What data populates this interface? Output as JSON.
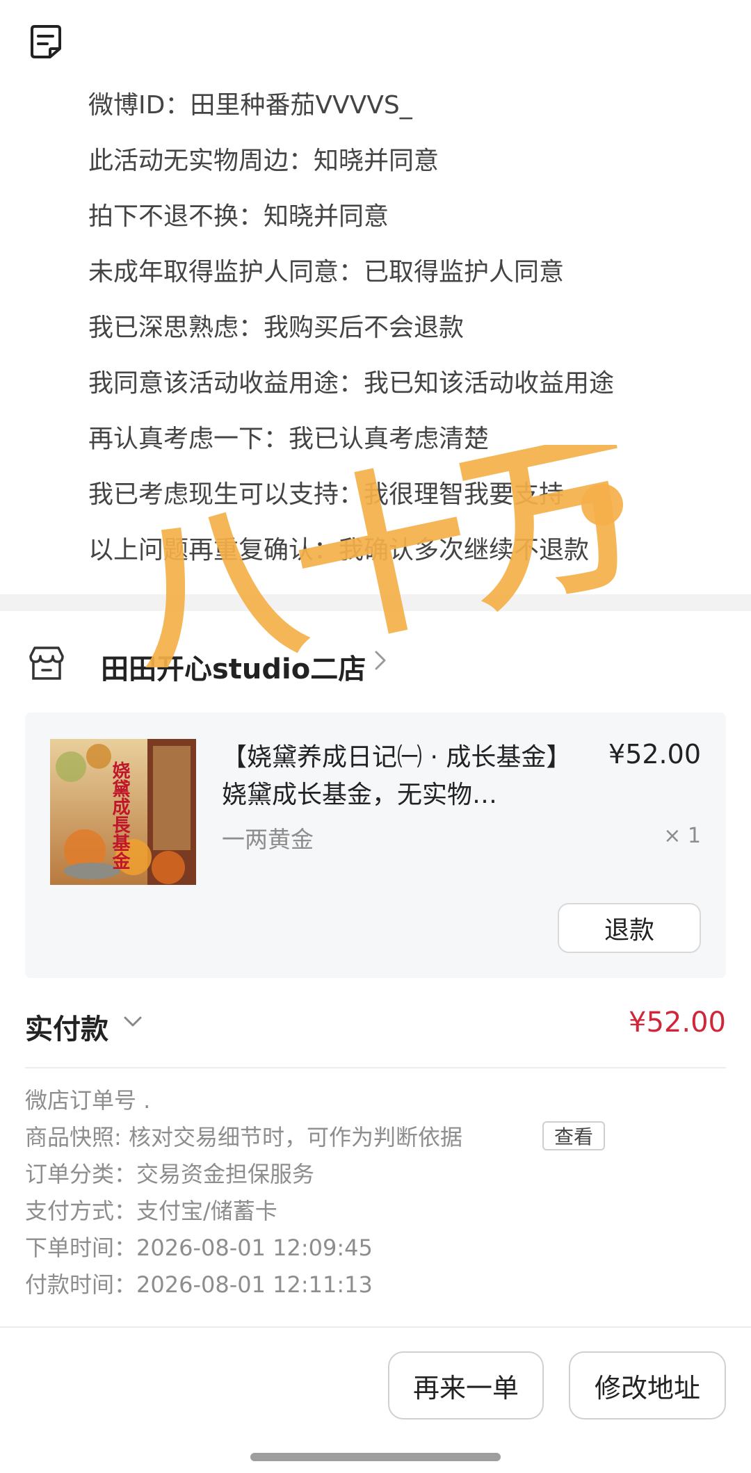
{
  "remarks": [
    "微博ID：田里种番茄VVVVS_",
    "此活动无实物周边：知晓并同意",
    "拍下不退不换：知晓并同意",
    "未成年取得监护人同意：已取得监护人同意",
    "我已深思熟虑：我购买后不会退款",
    "我同意该活动收益用途：我已知该活动收益用途",
    "再认真考虑一下：我已认真考虑清楚",
    "我已考虑现生可以支持：我很理智我要支持",
    "以上问题再重复确认：我确认多次继续不退款"
  ],
  "shop": {
    "name": "田田开心studio二店"
  },
  "product": {
    "title": "【娆黛养成日记㈠ · 成长基金】娆黛成长基金，无实物…",
    "price": "¥52.00",
    "spec": "一两黄金",
    "qty": "× 1",
    "refund_label": "退款",
    "thumb_text": "娆黛成長基金"
  },
  "payment": {
    "label": "实付款",
    "amount": "¥52.00"
  },
  "order_info": {
    "order_no": "微店订单号 .",
    "snapshot": "商品快照: 核对交易细节时，可作为判断依据",
    "view_label": "查看",
    "category": "订单分类：交易资金担保服务",
    "pay_method": "支付方式：支付宝/储蓄卡",
    "order_time": "下单时间：2026-08-01 12:09:45",
    "pay_time": "付款时间：2026-08-01 12:11:13"
  },
  "actions": {
    "reorder": "再来一单",
    "edit_address": "修改地址"
  },
  "overlay": "八十万",
  "colors": {
    "accent_red": "#d0263a",
    "overlay_orange": "#f5b04a",
    "card_bg": "#f5f7f9"
  }
}
